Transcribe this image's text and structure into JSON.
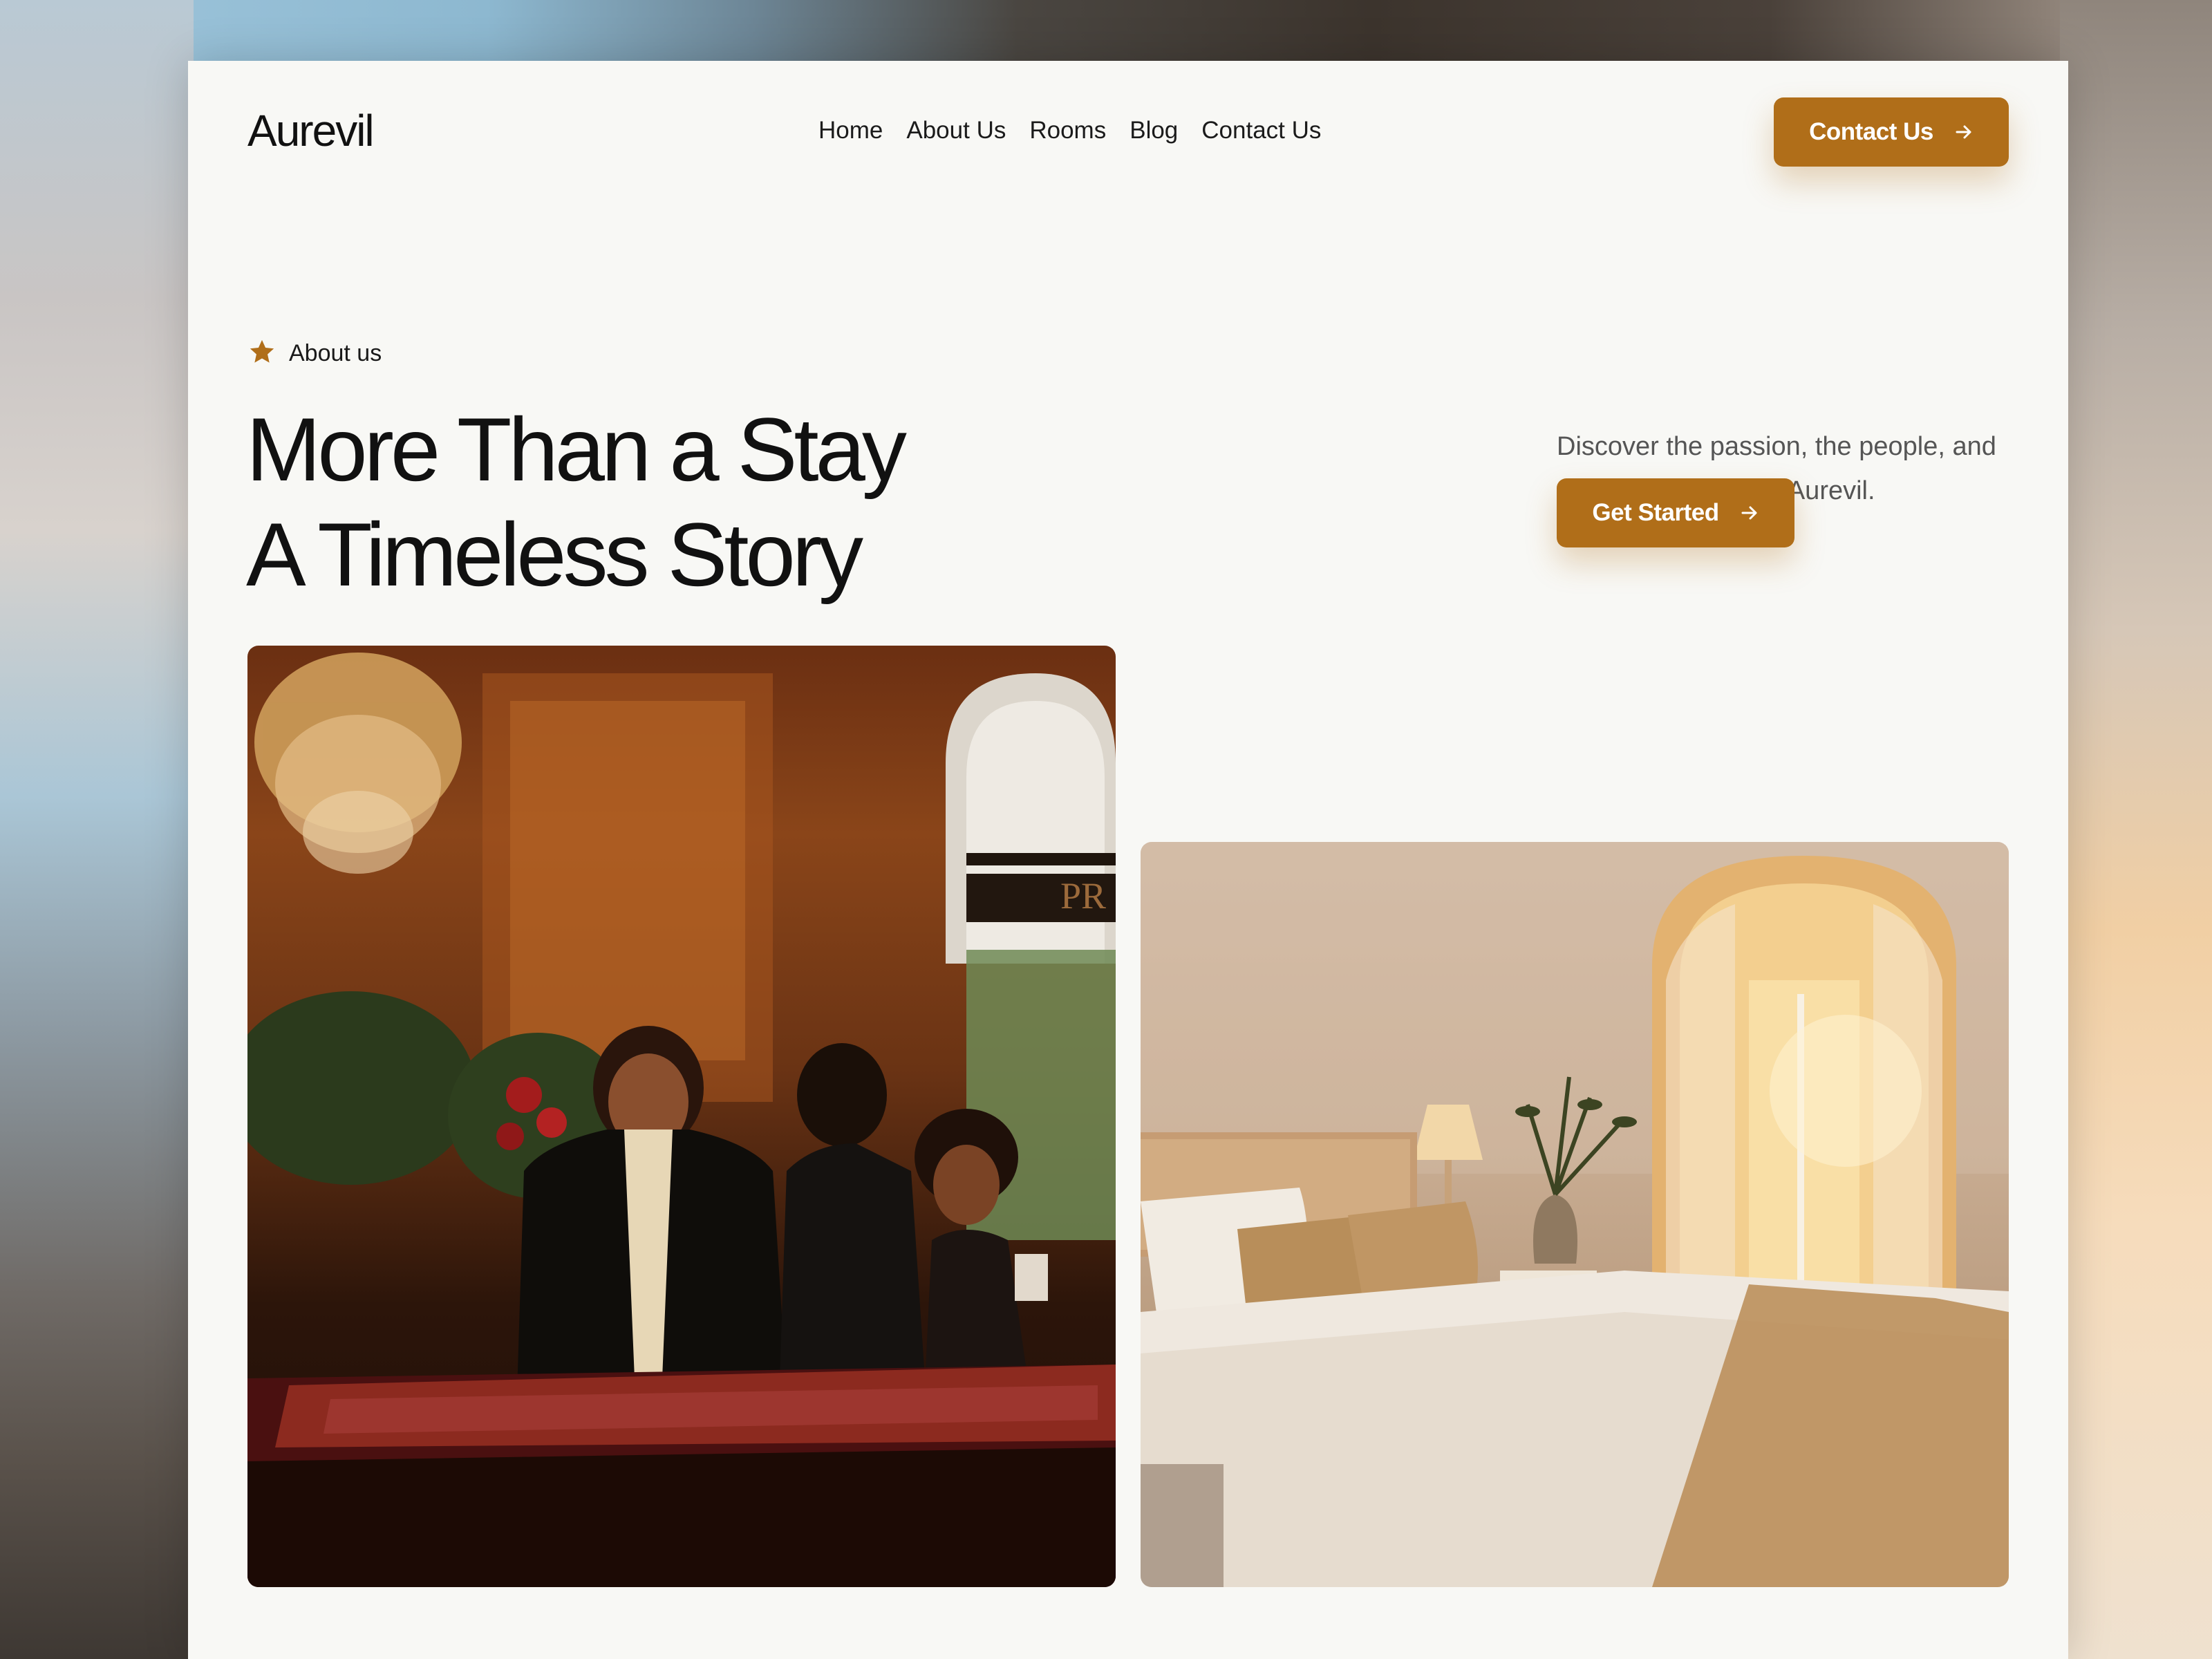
{
  "nav": {
    "logo": "Aurevil",
    "items": [
      {
        "label": "Home"
      },
      {
        "label": "About Us"
      },
      {
        "label": "Rooms"
      },
      {
        "label": "Blog"
      },
      {
        "label": "Contact Us"
      }
    ],
    "cta_label": "Contact Us"
  },
  "hero": {
    "eyebrow": "About us",
    "title_line1": "More Than a Stay",
    "title_line2": "A Timeless Story",
    "description": "Discover the passion, the people, and the purpose behind Aurevil.",
    "cta_label": "Get Started"
  },
  "images": {
    "lobby_sign_text": "PR"
  },
  "colors": {
    "accent": "#b06e19",
    "page_background": "#f8f8f5",
    "heading": "#111111",
    "body_text": "#555555"
  },
  "icons": [
    "star-icon",
    "arrow-right-icon"
  ]
}
